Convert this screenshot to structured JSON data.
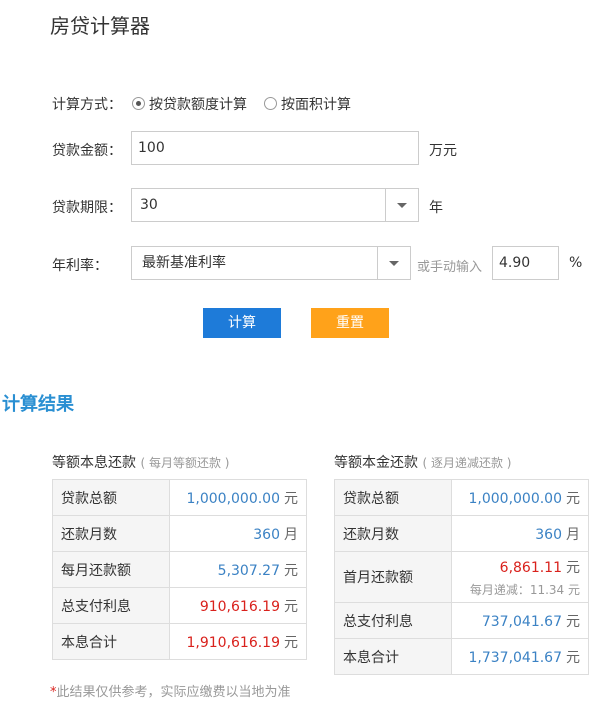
{
  "title": "房贷计算器",
  "form": {
    "method_label": "计算方式：",
    "method_options": [
      "按贷款额度计算",
      "按面积计算"
    ],
    "amount_label": "贷款金额：",
    "amount_value": "100",
    "amount_unit": "万元",
    "term_label": "贷款期限：",
    "term_value": "30",
    "term_unit": "年",
    "rate_label": "年利率：",
    "rate_select": "最新基准利率",
    "rate_manual_label": "或手动输入",
    "rate_value": "4.90",
    "rate_unit": "%"
  },
  "buttons": {
    "calc": "计算",
    "reset": "重置"
  },
  "result_title": "计算结果",
  "left": {
    "title": "等额本息还款",
    "subtitle": "( 每月等额还款 )",
    "rows": [
      {
        "k": "贷款总额",
        "v": "1,000,000.00",
        "u": "元"
      },
      {
        "k": "还款月数",
        "v": "360",
        "u": "月"
      },
      {
        "k": "每月还款额",
        "v": "5,307.27",
        "u": "元"
      },
      {
        "k": "总支付利息",
        "v": "910,616.19",
        "u": "元"
      },
      {
        "k": "本息合计",
        "v": "1,910,616.19",
        "u": "元"
      }
    ]
  },
  "right": {
    "title": "等额本金还款",
    "subtitle": "( 逐月递减还款 )",
    "rows": [
      {
        "k": "贷款总额",
        "v": "1,000,000.00",
        "u": "元"
      },
      {
        "k": "还款月数",
        "v": "360",
        "u": "月"
      },
      {
        "k": "首月还款额",
        "v": "6,861.11",
        "u": "元",
        "sub": "每月递减：11.34 元"
      },
      {
        "k": "总支付利息",
        "v": "737,041.67",
        "u": "元"
      },
      {
        "k": "本息合计",
        "v": "1,737,041.67",
        "u": "元"
      }
    ]
  },
  "note": {
    "star": "*",
    "text": "此结果仅供参考，实际应缴费以当地为准"
  },
  "colors": {
    "accent_blue": "#2a8fd2",
    "button_blue": "#1e7bd9",
    "button_orange": "#ffa21a",
    "value_red": "#d9211c",
    "value_blue": "#3b82c4"
  }
}
